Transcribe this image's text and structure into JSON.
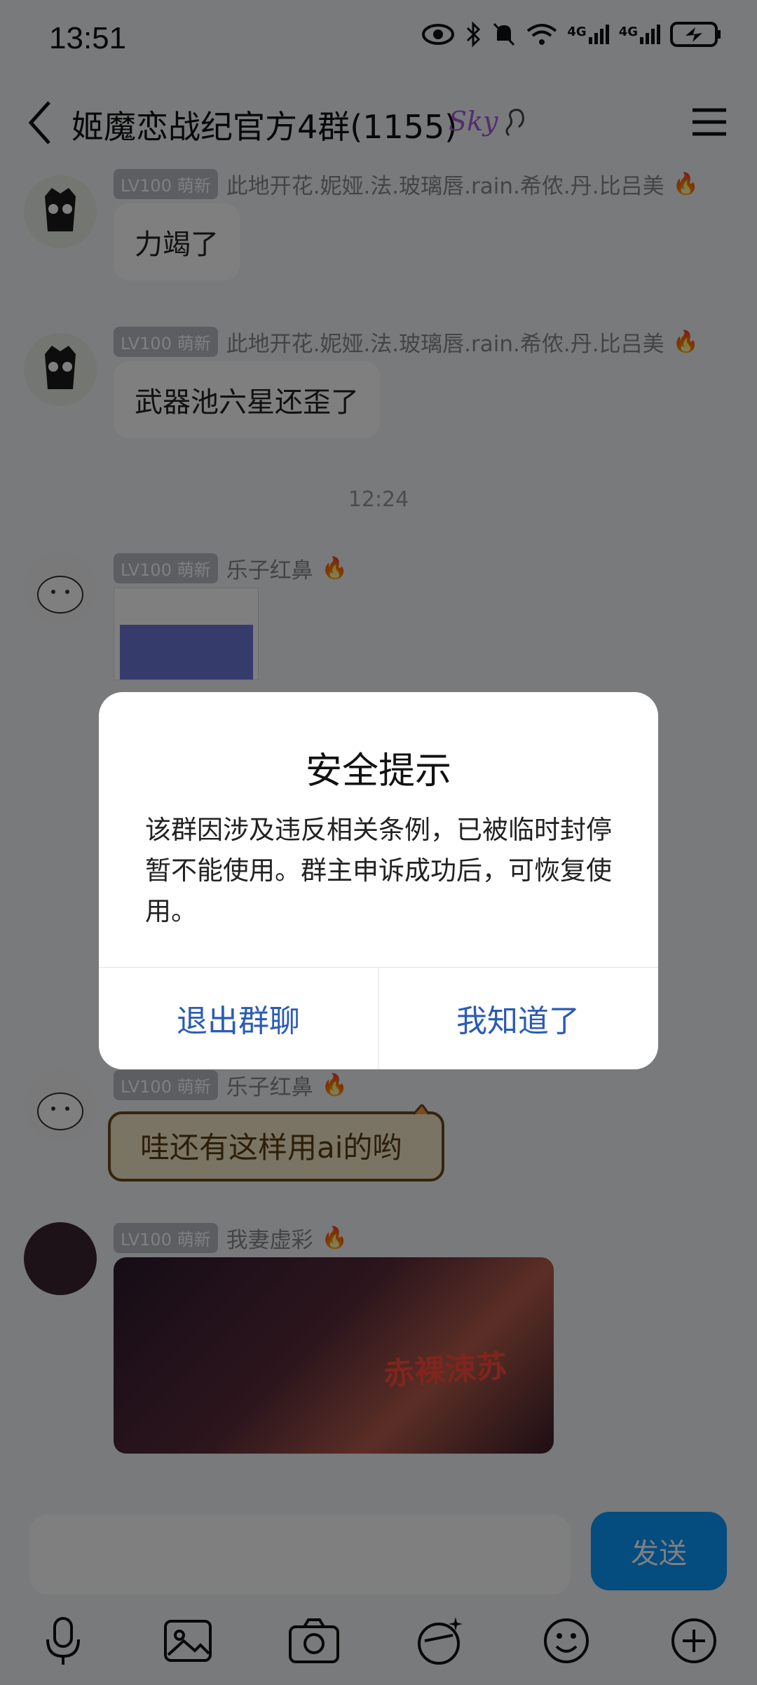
{
  "status_bar": {
    "time": "13:51",
    "network_labels": [
      "4G",
      "4G"
    ]
  },
  "header": {
    "title": "姬魔恋战纪官方4群(1155)",
    "badge": "Sky"
  },
  "messages": [
    {
      "level": "LV100 萌新",
      "nickname": "此地开花.妮娅.法.玻璃唇.rain.希侬.丹.比吕美",
      "text": "力竭了"
    },
    {
      "level": "LV100 萌新",
      "nickname": "此地开花.妮娅.法.玻璃唇.rain.希侬.丹.比吕美",
      "text": "武器池六星还歪了"
    },
    {
      "level": "LV100 萌新",
      "nickname": "乐子红鼻"
    },
    {
      "level": "LV100 萌新",
      "nickname": "乐子红鼻",
      "text": "哇还有这样用ai的哟"
    },
    {
      "level": "LV100 萌新",
      "nickname": "我妻虚彩",
      "image_text": "赤裸涑苏"
    }
  ],
  "time_separator": "12:24",
  "input": {
    "placeholder": "",
    "send_label": "发送"
  },
  "dialog": {
    "title": "安全提示",
    "body": "该群因涉及违反相关条例，已被临时封停暂不能使用。群主申诉成功后，可恢复使用。",
    "buttons": {
      "exit": "退出群聊",
      "ok": "我知道了"
    }
  },
  "colors": {
    "send_button": "#0a99ff",
    "dialog_button_text": "#2b5bb5",
    "level_badge": "#b9bdc5"
  },
  "icons": [
    "eye-icon",
    "bluetooth-icon",
    "mute-bell-icon",
    "wifi-icon",
    "signal-icon",
    "battery-charging-icon",
    "back-icon",
    "menu-icon",
    "mic-icon",
    "image-icon",
    "camera-icon",
    "face-effect-icon",
    "emoji-icon",
    "plus-icon"
  ]
}
